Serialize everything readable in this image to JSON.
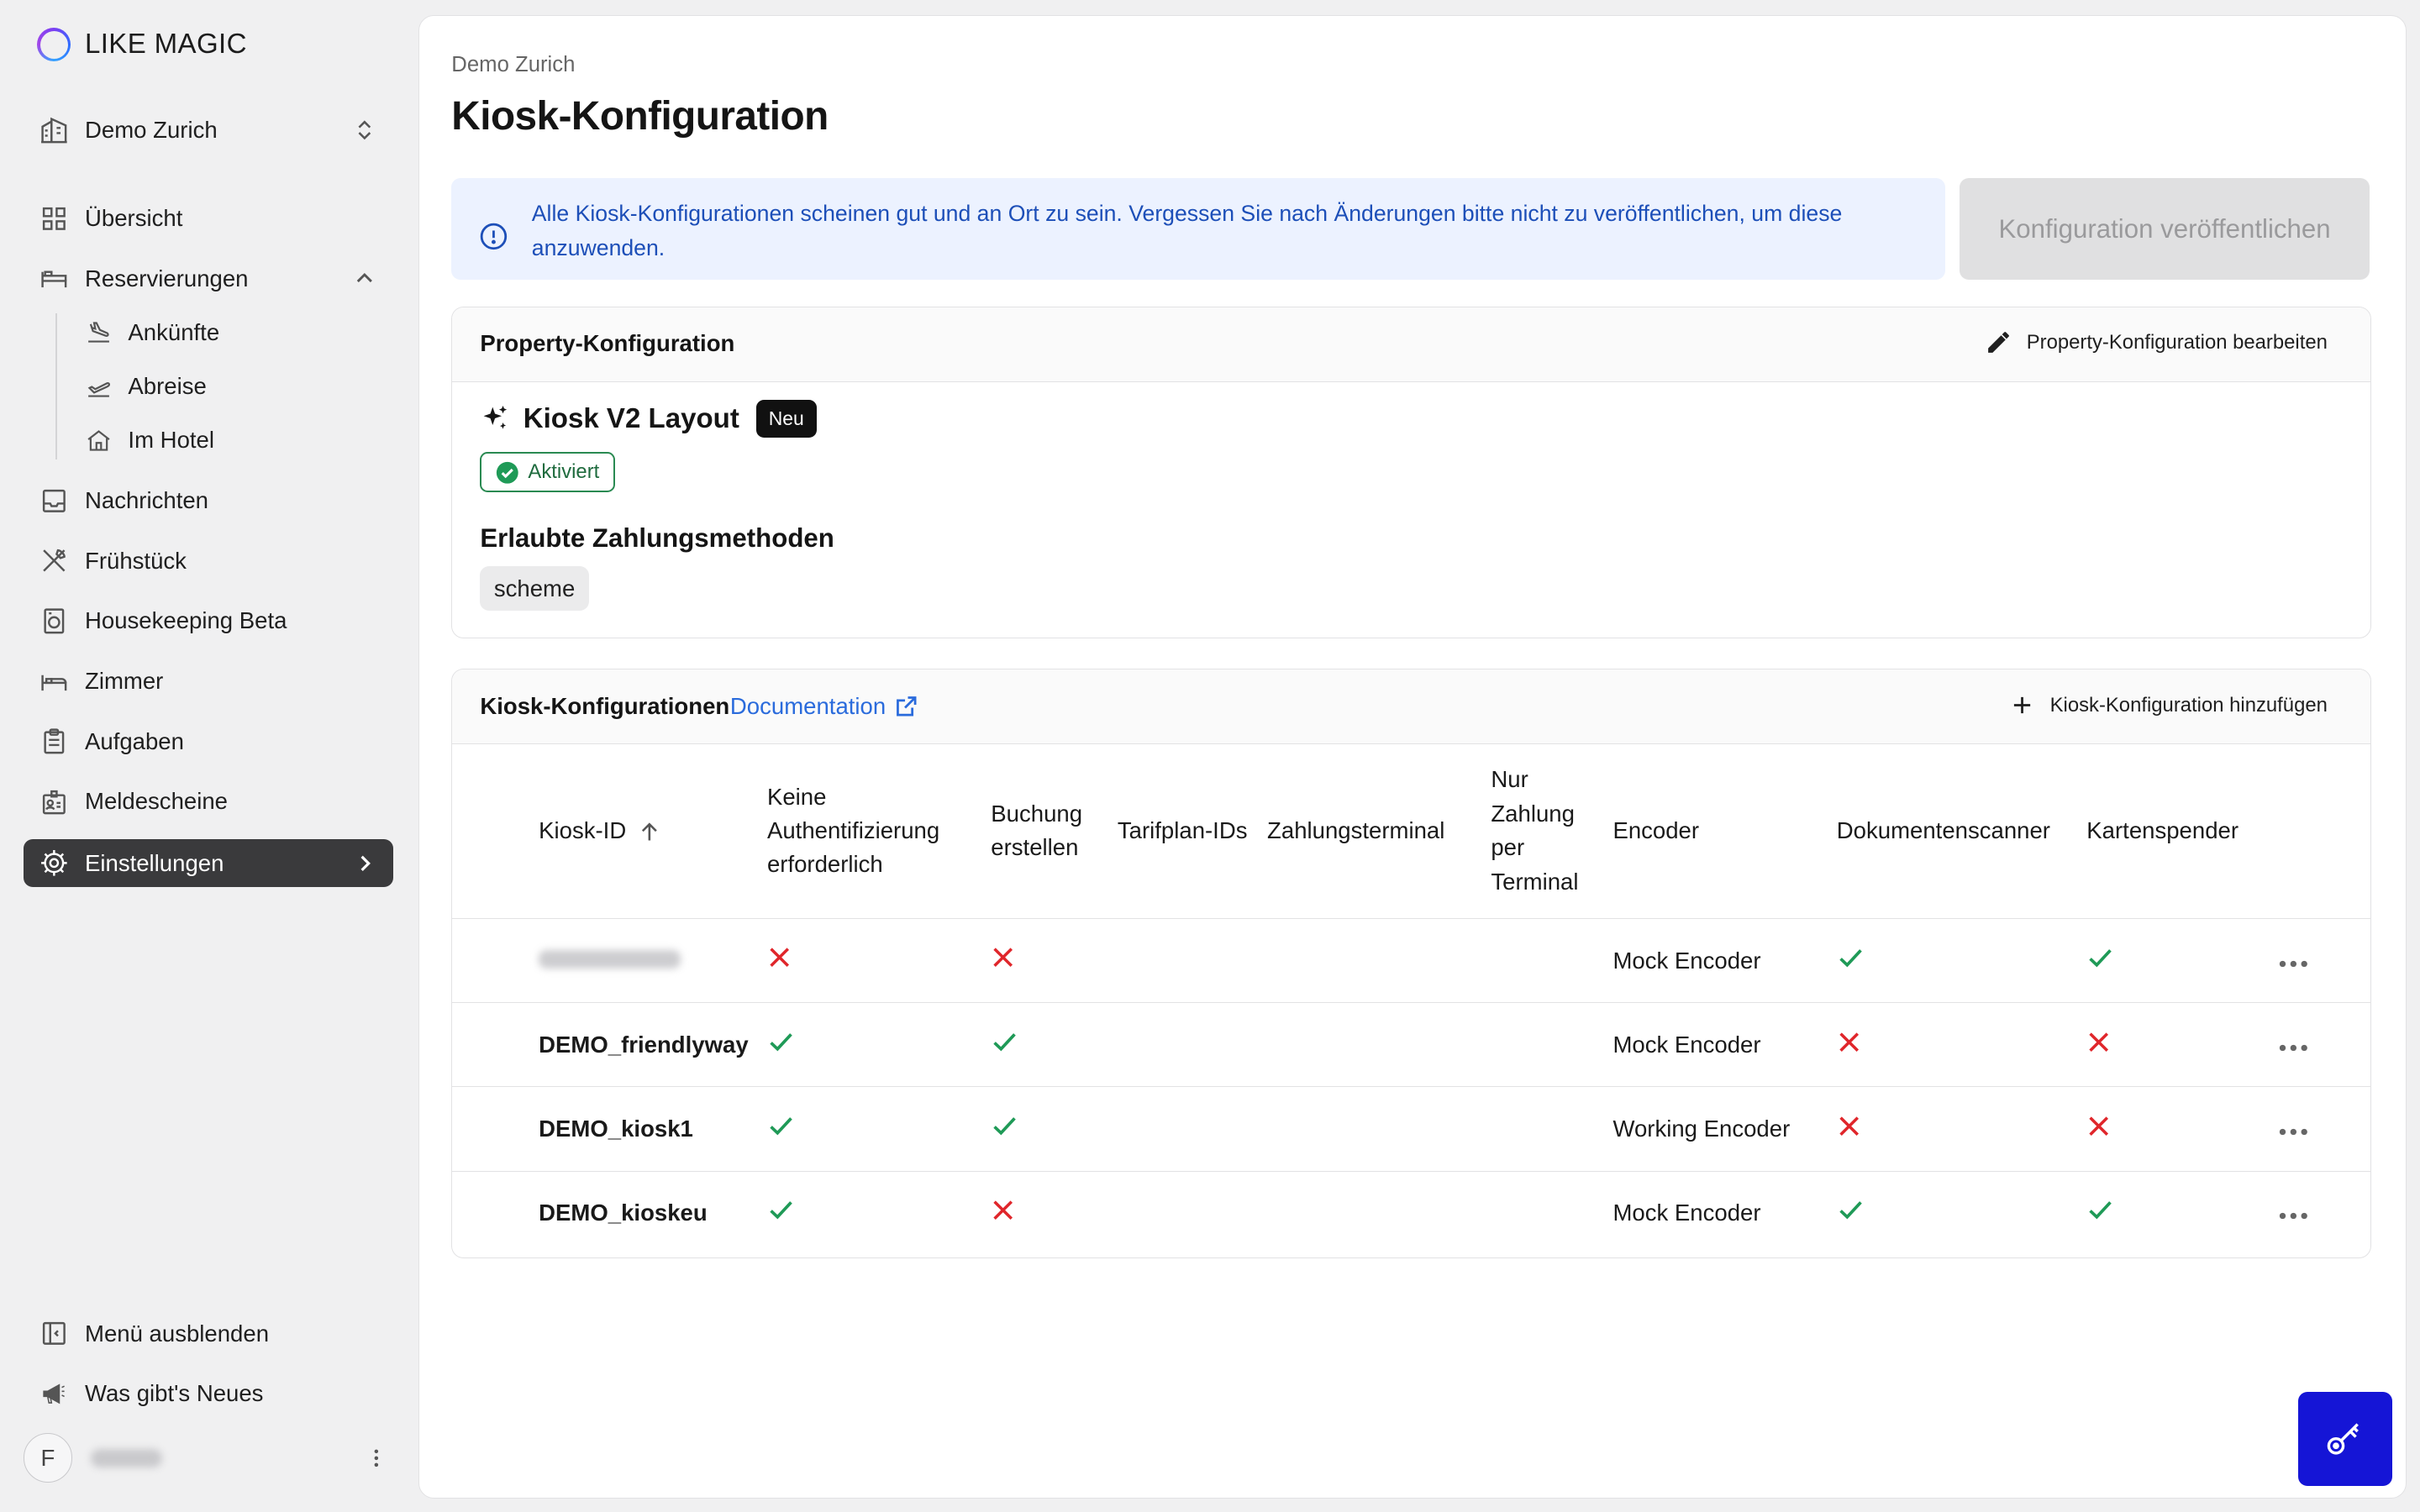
{
  "app": {
    "brand": "LIKE MAGIC"
  },
  "sidebar": {
    "property_selector": "Demo Zurich",
    "items": {
      "overview": "Übersicht",
      "reservations": "Reservierungen",
      "arrivals": "Ankünfte",
      "departures": "Abreise",
      "in_hotel": "Im Hotel",
      "messages": "Nachrichten",
      "breakfast": "Frühstück",
      "housekeeping": "Housekeeping Beta",
      "rooms": "Zimmer",
      "tasks": "Aufgaben",
      "registration_forms": "Meldescheine",
      "settings": "Einstellungen"
    },
    "footer": {
      "hide_menu": "Menü ausblenden",
      "whats_new": "Was gibt's Neues",
      "avatar_initial": "F"
    }
  },
  "header": {
    "breadcrumb": "Demo Zurich",
    "title": "Kiosk-Konfiguration"
  },
  "alert": {
    "text": "Alle Kiosk-Konfigurationen scheinen gut und an Ort zu sein. Vergessen Sie nach Änderungen bitte nicht zu veröffentlichen, um diese anzuwenden."
  },
  "publish_button": {
    "label": "Konfiguration veröffentlichen",
    "disabled": true
  },
  "property_config": {
    "title": "Property-Konfiguration",
    "edit_label": "Property-Konfiguration bearbeiten",
    "feature_title": "Kiosk V2 Layout",
    "feature_badge": "Neu",
    "status": "Aktiviert",
    "payment_title": "Erlaubte Zahlungsmethoden",
    "payment_methods": [
      "scheme"
    ]
  },
  "kiosk_configs": {
    "title": "Kiosk-Konfigurationen",
    "doc_link": "Documentation",
    "add_label": "Kiosk-Konfiguration hinzufügen",
    "columns": {
      "kiosk_id": "Kiosk-ID",
      "no_auth": "Keine Authentifizierung erforderlich",
      "create_booking": "Buchung erstellen",
      "rate_plan_ids": "Tarifplan-IDs",
      "payment_terminal": "Zahlungsterminal",
      "terminal_only": "Nur Zahlung per Terminal",
      "encoder": "Encoder",
      "document_scanner": "Dokumentenscanner",
      "card_dispenser": "Kartenspender"
    },
    "rows": [
      {
        "id": "",
        "id_redacted": true,
        "no_auth": false,
        "create_booking": false,
        "rate_plan_ids": "",
        "payment_terminal": "",
        "terminal_only": "",
        "encoder": "Mock Encoder",
        "document_scanner": true,
        "card_dispenser": true
      },
      {
        "id": "DEMO_friendlyway",
        "no_auth": true,
        "create_booking": true,
        "rate_plan_ids": "",
        "payment_terminal": "",
        "terminal_only": "",
        "encoder": "Mock Encoder",
        "document_scanner": false,
        "card_dispenser": false
      },
      {
        "id": "DEMO_kiosk1",
        "no_auth": true,
        "create_booking": true,
        "rate_plan_ids": "",
        "payment_terminal": "",
        "terminal_only": "",
        "encoder": "Working Encoder",
        "document_scanner": false,
        "card_dispenser": false
      },
      {
        "id": "DEMO_kioskeu",
        "no_auth": true,
        "create_booking": false,
        "rate_plan_ids": "",
        "payment_terminal": "",
        "terminal_only": "",
        "encoder": "Mock Encoder",
        "document_scanner": true,
        "card_dispenser": true
      }
    ]
  },
  "colors": {
    "check": "#1f9a57",
    "cross": "#e0262b",
    "accent": "#2a6bdc",
    "fab": "#1515d6",
    "alert_text": "#1d4fb8"
  },
  "icons": {
    "fab": "key-icon"
  }
}
